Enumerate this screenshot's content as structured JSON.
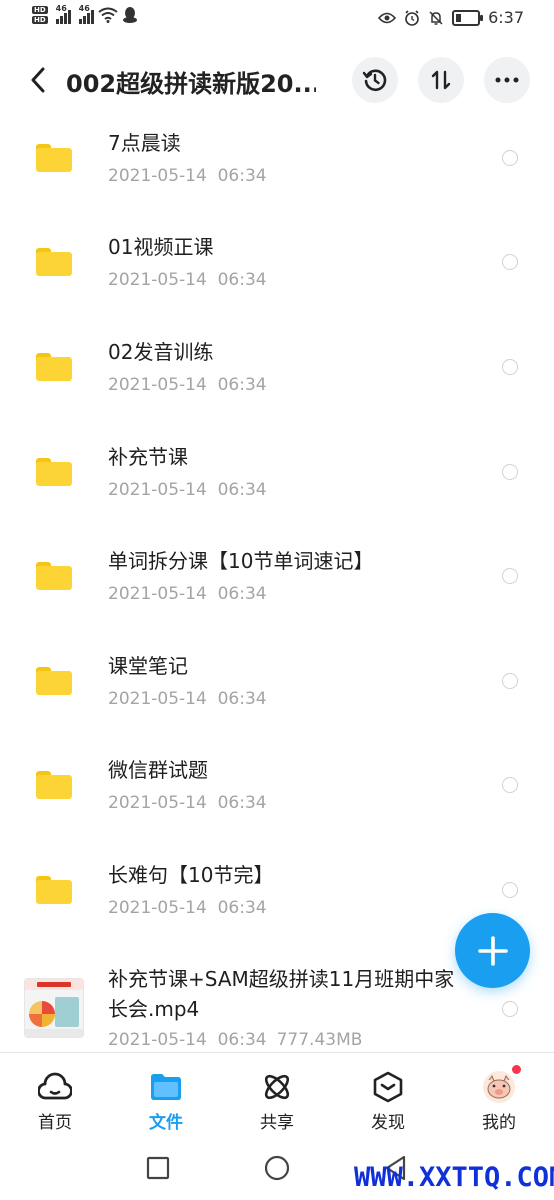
{
  "status_bar": {
    "net1": "46",
    "net2": "46",
    "time": "6:37",
    "battery_level": 0.25,
    "icons": [
      "hd-icon",
      "signal-icon",
      "wifi-icon",
      "qq-icon",
      "eye-icon",
      "alarm-icon",
      "bell-off-icon",
      "battery-icon"
    ]
  },
  "header": {
    "title": "002超级拼读新版20...",
    "back_icon": "chevron-left-icon",
    "history_icon": "history-icon",
    "sort_icon": "sort-icon",
    "more_icon": "more-icon"
  },
  "files": [
    {
      "name": "7点晨读",
      "date": "2021-05-14  06:34",
      "type": "folder"
    },
    {
      "name": "01视频正课",
      "date": "2021-05-14  06:34",
      "type": "folder"
    },
    {
      "name": "02发音训练",
      "date": "2021-05-14  06:34",
      "type": "folder"
    },
    {
      "name": "补充节课",
      "date": "2021-05-14  06:34",
      "type": "folder"
    },
    {
      "name": "单词拆分课【10节单词速记】",
      "date": "2021-05-14  06:34",
      "type": "folder"
    },
    {
      "name": "课堂笔记",
      "date": "2021-05-14  06:34",
      "type": "folder"
    },
    {
      "name": "微信群试题",
      "date": "2021-05-14  06:34",
      "type": "folder"
    },
    {
      "name": "长难句【10节完】",
      "date": "2021-05-14  06:34",
      "type": "folder"
    },
    {
      "name": "补充节课+SAM超级拼读11月班期中家长会.mp4",
      "date": "2021-05-14  06:34",
      "size": "777.43MB",
      "type": "video"
    }
  ],
  "fab": {
    "icon": "plus-icon"
  },
  "bottom_nav": [
    {
      "label": "首页",
      "icon": "home-cloud-icon",
      "active": false
    },
    {
      "label": "文件",
      "icon": "folder-icon",
      "active": true
    },
    {
      "label": "共享",
      "icon": "share-atom-icon",
      "active": false
    },
    {
      "label": "发现",
      "icon": "discover-box-icon",
      "active": false
    },
    {
      "label": "我的",
      "icon": "avatar-icon",
      "active": false,
      "badge": true
    }
  ],
  "system_nav": [
    "recent-apps-icon",
    "home-circle-icon",
    "back-triangle-icon"
  ],
  "watermark": "WWW.XXTTQ.COM",
  "colors": {
    "accent": "#1a9ef0",
    "folder": "#fdd435",
    "badge": "#f5364b",
    "meta_text": "#a4a4a4"
  }
}
